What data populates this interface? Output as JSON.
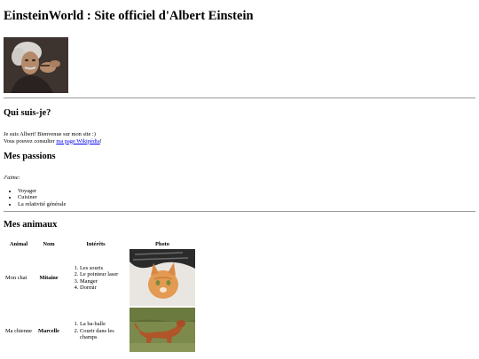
{
  "header": {
    "title": "EinsteinWorld : Site officiel d'Albert Einstein"
  },
  "portrait": {
    "alt": "Portrait d'Albert Einstein"
  },
  "about": {
    "heading": "Qui suis-je?",
    "line1": "Je suis Albert! Bienvenue sur mon site :)",
    "line2_prefix": "Vous pouvez consulter ",
    "link_label": "ma page Wikipédia",
    "line2_suffix": "!"
  },
  "passions": {
    "heading": "Mes passions",
    "intro": "J'aime:",
    "items": [
      "Voyager",
      "Cuisiner",
      "La relativité générale"
    ]
  },
  "animals": {
    "heading": "Mes animaux",
    "columns": [
      "Animal",
      "Nom",
      "Intérêts",
      "Photo"
    ],
    "rows": [
      {
        "animal": "Mon chat",
        "name": "Mitaine",
        "interests": [
          "Les souris",
          "Le pointeur laser",
          "Manger",
          "Dormir"
        ],
        "photo": "cat-photo"
      },
      {
        "animal": "Ma chienne",
        "name": "Marcelle",
        "interests": [
          "La ba-balle",
          "Courir dans les champs"
        ],
        "photo": "dog-photo"
      }
    ]
  },
  "colors": {
    "link": "#0000ee",
    "rule": "#9a9a9a"
  }
}
